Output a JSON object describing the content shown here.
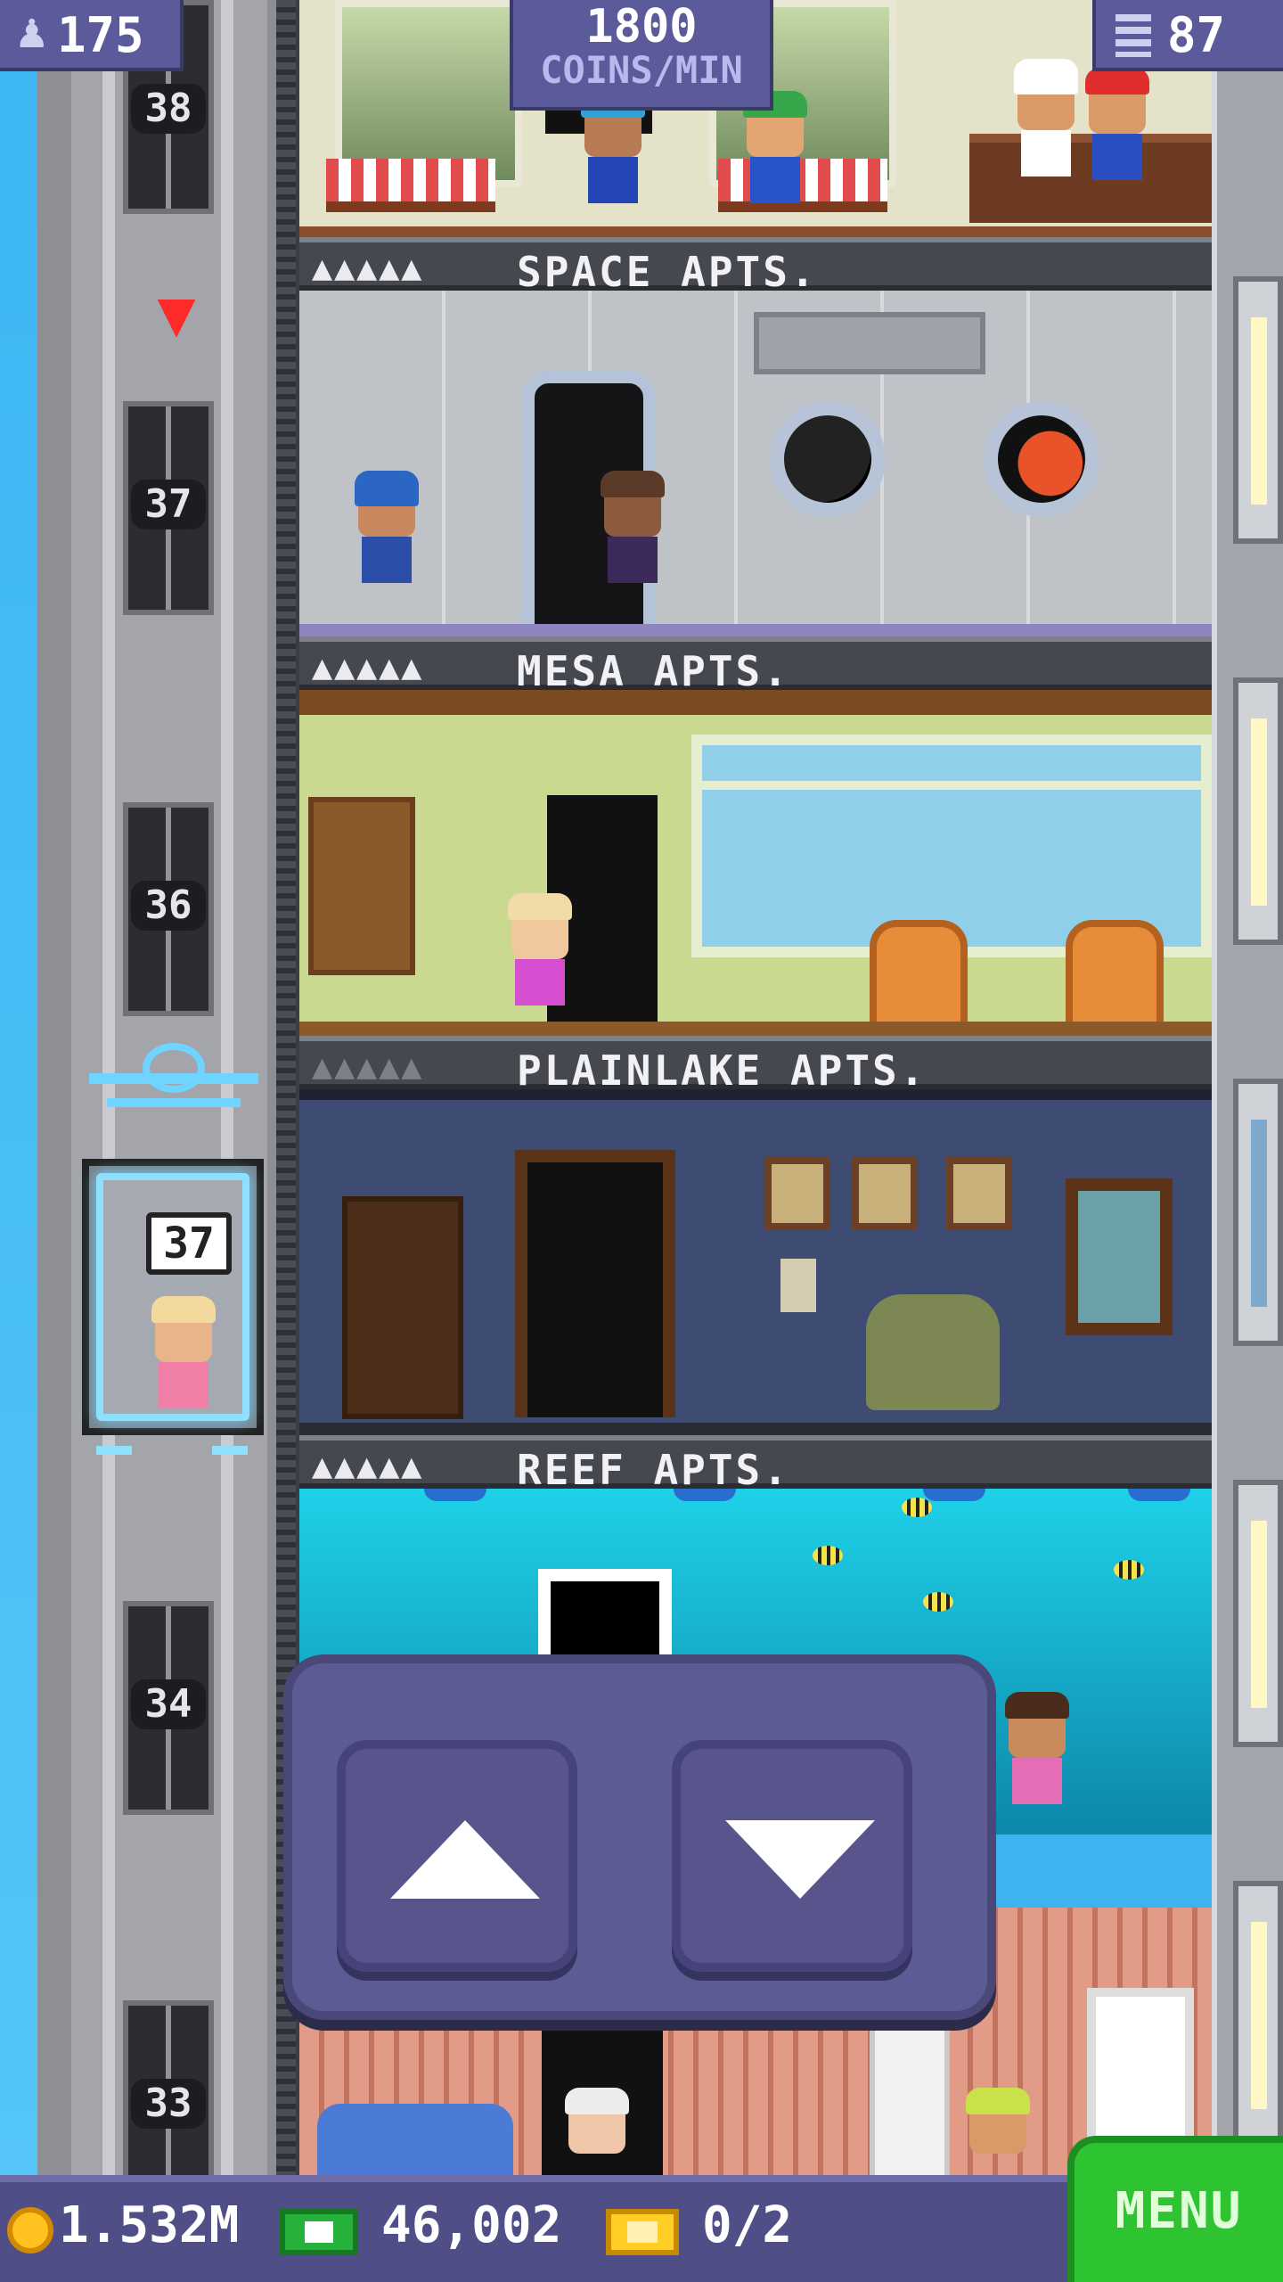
{
  "hud": {
    "population": "175",
    "coins_per_min_value": "1800",
    "coins_per_min_unit": "COINS/MIN",
    "floor_count": "87",
    "icons": {
      "population": "person-icon",
      "floors": "building-icon"
    }
  },
  "shaft": {
    "stops": [
      {
        "number": "38"
      },
      {
        "number": "37"
      },
      {
        "number": "36"
      },
      {
        "number": "34"
      },
      {
        "number": "33"
      }
    ],
    "heart_icon": "heart-icon",
    "elevator": {
      "destination": "37",
      "border_color": "#8fe0ff"
    }
  },
  "floors": [
    {
      "name": "SPACE APTS.",
      "residents": "▲▲▲▲▲",
      "residents_full": true
    },
    {
      "name": "MESA APTS.",
      "residents": "▲▲▲▲▲",
      "residents_full": true
    },
    {
      "name": "PLAINLAKE APTS.",
      "residents": "▲▲▲▲▲",
      "residents_full": false
    },
    {
      "name": "REEF APTS.",
      "residents": "▲▲▲▲▲",
      "residents_full": true
    }
  ],
  "controls": {
    "up": {
      "icon": "up-arrow-icon"
    },
    "down": {
      "icon": "down-arrow-icon"
    }
  },
  "bottom": {
    "coins": "1.532M",
    "bux": "46,002",
    "tickets": "0/2",
    "menu_label": "MENU",
    "icons": {
      "coins": "coin-icon",
      "bux": "bux-icon",
      "tickets": "ticket-icon"
    }
  },
  "colors": {
    "hud_panel": "#5b5b9b",
    "menu_green": "#2ec331",
    "sky": "#3fb3ef"
  }
}
